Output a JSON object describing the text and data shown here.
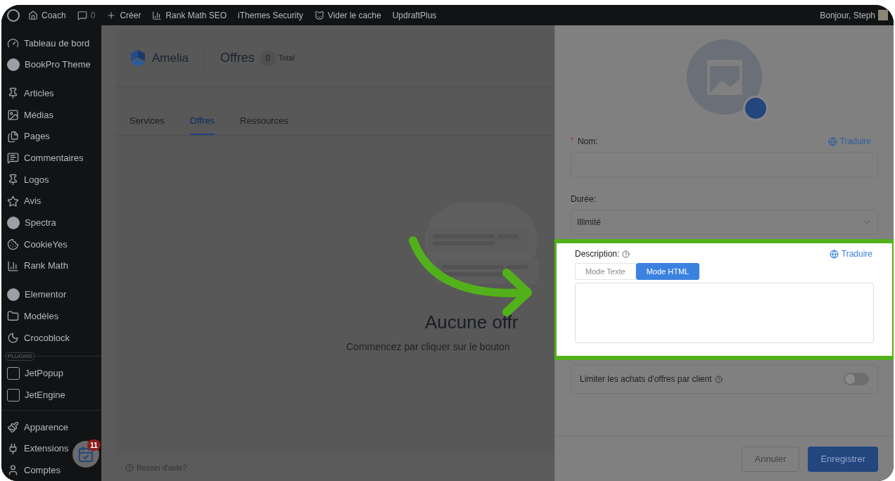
{
  "admin_bar": {
    "items": [
      {
        "label": "Coach"
      },
      {
        "label": "0"
      },
      {
        "label": "Créer"
      },
      {
        "label": "Rank Math SEO"
      },
      {
        "label": "iThemes Security"
      },
      {
        "label": "Vider le cache"
      },
      {
        "label": "UpdraftPlus"
      }
    ],
    "greeting": "Bonjour, Steph"
  },
  "sidebar": {
    "sections": [
      {
        "items": [
          {
            "label": "Tableau de bord"
          },
          {
            "label": "BookPro Theme"
          }
        ]
      },
      {
        "items": [
          {
            "label": "Articles"
          },
          {
            "label": "Médias"
          },
          {
            "label": "Pages"
          },
          {
            "label": "Commentaires"
          },
          {
            "label": "Logos"
          },
          {
            "label": "Avis"
          },
          {
            "label": "Spectra"
          },
          {
            "label": "CookieYes"
          },
          {
            "label": "Rank Math"
          }
        ]
      },
      {
        "items": [
          {
            "label": "Elementor"
          },
          {
            "label": "Modèles"
          },
          {
            "label": "Crocoblock"
          }
        ]
      },
      {
        "tag": "PLUGINS",
        "items": [
          {
            "label": "JetPopup"
          },
          {
            "label": "JetEngine"
          }
        ]
      },
      {
        "items": [
          {
            "label": "Apparence"
          },
          {
            "label": "Extensions"
          },
          {
            "label": "Comptes"
          }
        ]
      }
    ]
  },
  "notification_badge": "11",
  "header": {
    "logo": "Amelia",
    "title": "Offres",
    "count": "0",
    "count_label": "Total"
  },
  "tabs": [
    {
      "label": "Services",
      "selected": false
    },
    {
      "label": "Offres",
      "selected": true
    },
    {
      "label": "Ressources",
      "selected": false
    }
  ],
  "empty_state": {
    "title": "Aucune offr",
    "text": "Commencez par cliquer sur le bouton"
  },
  "help_link": "Besoin d'aide?",
  "panel": {
    "name": {
      "required_mark": "*",
      "label": "Nom:",
      "translate": "Traduire"
    },
    "duration": {
      "label": "Durée:",
      "value": "Illimité"
    },
    "description": {
      "label": "Description:",
      "translate": "Traduire",
      "highlighted": true,
      "modes": [
        {
          "label": "Mode Texte",
          "selected": false
        },
        {
          "label": "Mode HTML",
          "selected": true
        }
      ]
    },
    "limit": {
      "label": "Limiter les achats d'offres par client",
      "on": false
    },
    "buttons": {
      "cancel": "Annuler",
      "save": "Enregistrer"
    }
  }
}
